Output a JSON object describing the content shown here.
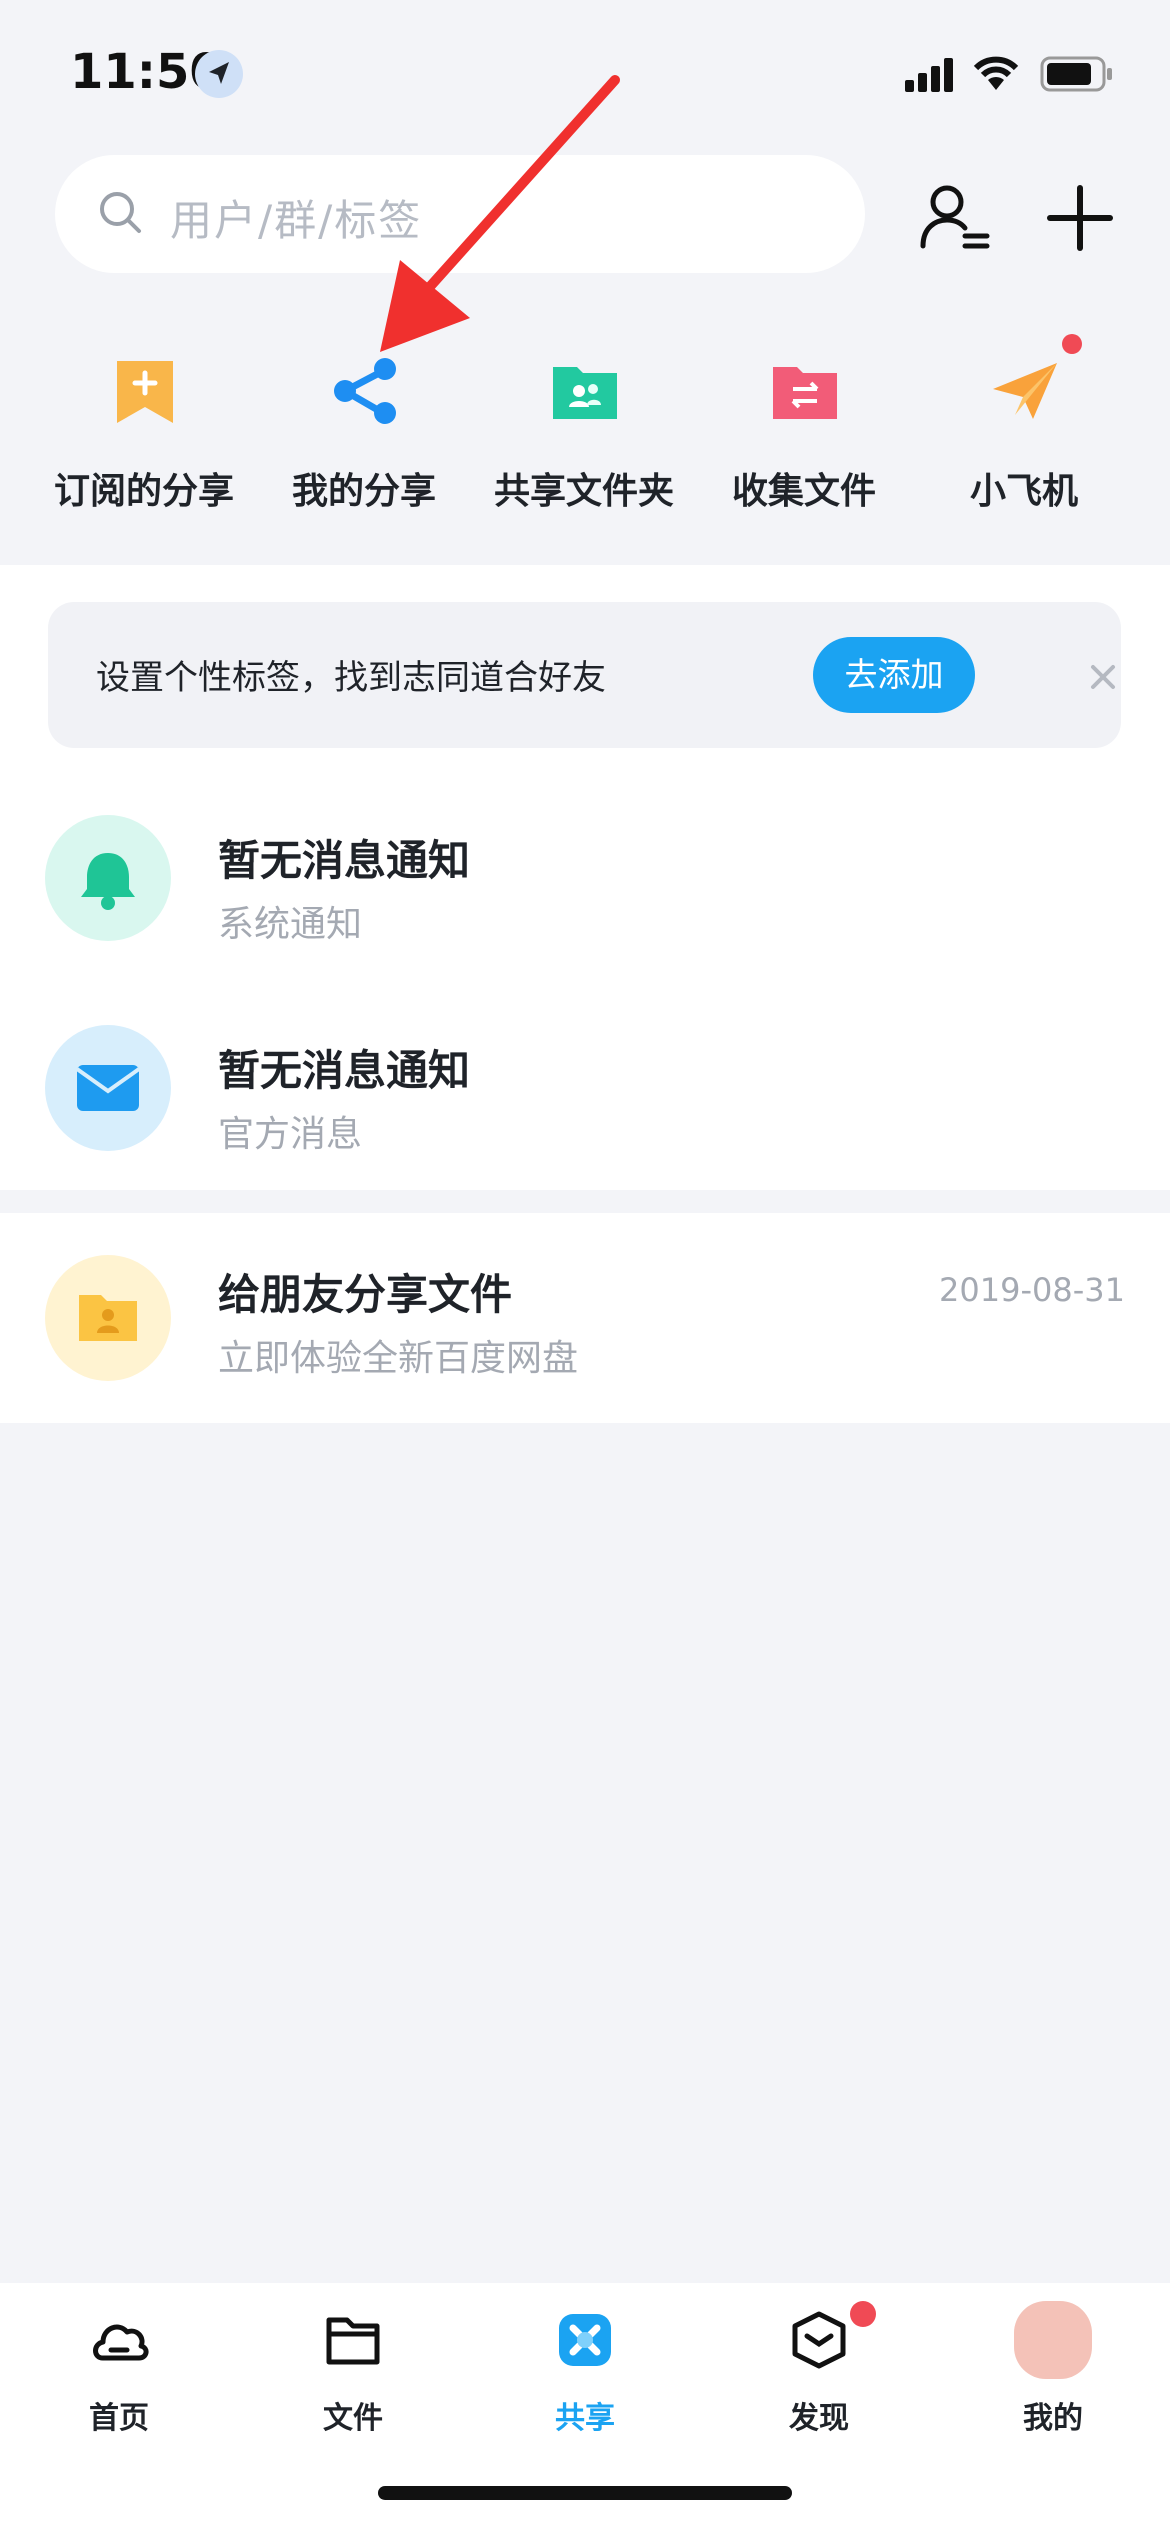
{
  "status_bar": {
    "time": "11:50"
  },
  "search": {
    "placeholder": "用户/群/标签"
  },
  "quick_actions": [
    {
      "label": "订阅的分享",
      "icon": "bookmark-plus-icon",
      "color": "#f7a93a"
    },
    {
      "label": "我的分享",
      "icon": "share-icon",
      "color": "#1e8ef2"
    },
    {
      "label": "共享文件夹",
      "icon": "shared-folder-icon",
      "color": "#22c9a0"
    },
    {
      "label": "收集文件",
      "icon": "collect-folder-icon",
      "color": "#f25c78"
    },
    {
      "label": "小飞机",
      "icon": "paper-plane-icon",
      "color": "#f9a23b",
      "has_badge": true
    }
  ],
  "tag_banner": {
    "text": "设置个性标签，找到志同道合好友",
    "button": "去添加"
  },
  "messages": [
    {
      "title": "暂无消息通知",
      "subtitle": "系统通知",
      "icon": "bell-icon",
      "bg": "#d9f7ef"
    },
    {
      "title": "暂无消息通知",
      "subtitle": "官方消息",
      "icon": "mail-icon",
      "bg": "#d7eefc"
    }
  ],
  "share_item": {
    "title": "给朋友分享文件",
    "subtitle": "立即体验全新百度网盘",
    "date": "2019-08-31",
    "icon": "user-folder-icon",
    "bg": "#fff3d1"
  },
  "tabs": [
    {
      "label": "首页",
      "icon": "cloud-icon"
    },
    {
      "label": "文件",
      "icon": "folder-icon"
    },
    {
      "label": "共享",
      "icon": "share-tab-icon",
      "active": true
    },
    {
      "label": "发现",
      "icon": "discover-box-icon",
      "has_badge": true
    },
    {
      "label": "我的",
      "icon": "avatar-icon"
    }
  ],
  "colors": {
    "accent": "#1ba3f2",
    "badge": "#f04a55",
    "annotation_arrow": "#f0302e"
  }
}
